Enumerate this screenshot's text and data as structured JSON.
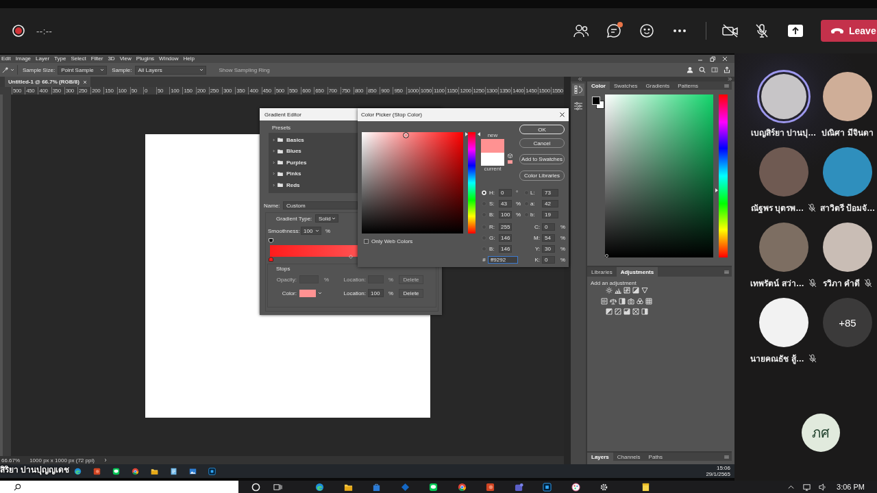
{
  "meeting_bar": {
    "recording_time": "--:--",
    "chat_unread": true,
    "camera_on": false,
    "mic_on": false,
    "leave": "Leave"
  },
  "photoshop": {
    "menu": [
      "Edit",
      "Image",
      "Layer",
      "Type",
      "Select",
      "Filter",
      "3D",
      "View",
      "Plugins",
      "Window",
      "Help"
    ],
    "options": {
      "sample_size_label": "Sample Size:",
      "sample_size": "Point Sample",
      "sample_label": "Sample:",
      "sample": "All Layers",
      "sampling_ring": {
        "label": "Show Sampling Ring",
        "disabled": true
      }
    },
    "document_tab": "Untitled-1 @ 66.7% (RGB/8)",
    "ruler": [
      "500",
      "450",
      "400",
      "350",
      "300",
      "250",
      "200",
      "150",
      "100",
      "50",
      "0",
      "50",
      "100",
      "150",
      "200",
      "250",
      "300",
      "350",
      "400",
      "450",
      "500",
      "550",
      "600",
      "650",
      "700",
      "750",
      "800",
      "850",
      "900",
      "950",
      "1000",
      "1050",
      "1100",
      "1150",
      "1200",
      "1250",
      "1300",
      "1350",
      "1400",
      "1450",
      "1500",
      "1550"
    ],
    "status": [
      "66.67%",
      "1000 px x 1000 px (72 ppi)"
    ],
    "gradient_editor": {
      "title": "Gradient Editor",
      "presets_label": "Presets",
      "presets": [
        {
          "name": "Basics",
          "expanded": false
        },
        {
          "name": "Blues",
          "expanded": false
        },
        {
          "name": "Purples",
          "expanded": false
        },
        {
          "name": "Pinks",
          "expanded": false
        },
        {
          "name": "Reds",
          "expanded": false
        }
      ],
      "name_label": "Name:",
      "name": "Custom",
      "type_label": "Gradient Type:",
      "type": "Solid",
      "smoothness_label": "Smoothness:",
      "smoothness": "100",
      "smoothness_unit": "%",
      "gradient": [
        {
          "color": "#ff1c1c",
          "selected": false
        },
        {
          "color": "#ff9292",
          "selected": true
        }
      ],
      "stops_label": "Stops",
      "stop_rows": [
        {
          "kind": "opacity",
          "label": "Opacity:",
          "unit": "%",
          "location_label": "Location:",
          "location_unit": "%",
          "delete": "Delete",
          "disabled": true
        },
        {
          "kind": "color",
          "label": "Color:",
          "location_label": "Location:",
          "location": "100",
          "location_unit": "%",
          "delete": "Delete",
          "disabled": false
        }
      ]
    },
    "color_picker": {
      "title": "Color Picker (Stop Color)",
      "buttons": [
        {
          "label": "OK",
          "default": true
        },
        {
          "label": "Cancel",
          "default": false
        },
        {
          "label": "Add to Swatches",
          "default": false
        },
        {
          "label": "Color Libraries",
          "default": false
        }
      ],
      "new_label": "new",
      "current_label": "current",
      "swatches": [
        {
          "color": "#ff9292"
        },
        {
          "color": "#ffffff"
        }
      ],
      "web_safe_swatch": {
        "color": "#ff9999"
      },
      "hue_slider": {
        "level": 1
      },
      "fields": [
        {
          "label": "H:",
          "value": "0",
          "unit": "°",
          "selected": true
        },
        {
          "label": "S:",
          "value": "43",
          "unit": "%",
          "selected": false
        },
        {
          "label": "B:",
          "value": "100",
          "unit": "%",
          "selected": false
        },
        {
          "label": "R:",
          "value": "255",
          "selected": false
        },
        {
          "label": "G:",
          "value": "146",
          "selected": false
        },
        {
          "label": "B:",
          "value": "146",
          "selected": false
        }
      ],
      "lab_fields": [
        {
          "label": "L:",
          "value": "73",
          "selected": false
        },
        {
          "label": "a:",
          "value": "42",
          "selected": false
        },
        {
          "label": "b:",
          "value": "19",
          "selected": false
        }
      ],
      "cmyk_fields": [
        {
          "label": "C:",
          "value": "0",
          "unit": "%"
        },
        {
          "label": "M:",
          "value": "54",
          "unit": "%"
        },
        {
          "label": "Y:",
          "value": "30",
          "unit": "%"
        },
        {
          "label": "K:",
          "value": "0",
          "unit": "%"
        }
      ],
      "hex_label": "#",
      "hex": "ff9292",
      "only_web_colors": {
        "label": "Only Web Colors",
        "checked": false
      }
    },
    "color_panel": {
      "tabs": [
        {
          "label": "Color",
          "selected": true
        },
        {
          "label": "Swatches",
          "selected": false
        },
        {
          "label": "Gradients",
          "selected": false
        },
        {
          "label": "Patterns",
          "selected": false
        }
      ],
      "swatches": [
        {
          "color": "#000000"
        },
        {
          "color": "#ffffff"
        }
      ],
      "hue_slider": {
        "level": 0.41
      }
    },
    "adjustments_panel": {
      "tabs": [
        {
          "label": "Libraries",
          "selected": false
        },
        {
          "label": "Adjustments",
          "selected": true
        }
      ],
      "hint": "Add an adjustment"
    },
    "layers_panel": {
      "tabs": [
        {
          "label": "Layers",
          "selected": true
        },
        {
          "label": "Channels",
          "selected": false
        },
        {
          "label": "Paths",
          "selected": false
        }
      ]
    }
  },
  "presenter_taskbar": {
    "time": "15:06",
    "date": "29/1/2565"
  },
  "presenter_name": "สิริยา ปานปุญญเดช",
  "participants": [
    {
      "name": "เบญสิร์ยา ปานปุ…",
      "speaking": true,
      "muted": false
    },
    {
      "name": "ปณิศา มีจินดา",
      "speaking": false,
      "muted": false
    },
    {
      "name": "ณัฐพร บุตรพ…",
      "speaking": false,
      "muted": true
    },
    {
      "name": "สาวิตรี ป้อมจั…",
      "speaking": false,
      "muted": false
    },
    {
      "name": "เทพรัตน์ สว่า…",
      "speaking": false,
      "muted": true
    },
    {
      "name": "รวิภา คำดี",
      "speaking": false,
      "muted": true
    },
    {
      "name": "นายคณธัช สู้…",
      "speaking": false,
      "muted": true
    }
  ],
  "overflow_count": "+85",
  "self_view": {
    "initials": "ภศ"
  },
  "taskbar": {
    "time": "3:06 PM"
  }
}
